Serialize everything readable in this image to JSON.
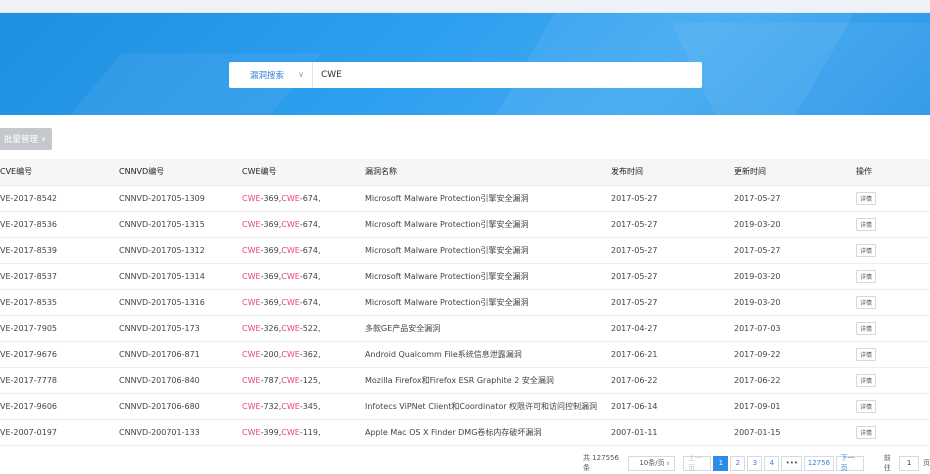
{
  "search": {
    "type_label": "漏洞搜索",
    "value": "CWE"
  },
  "toolbar": {
    "batch_label": "批量管理"
  },
  "table": {
    "headers": [
      "CVE编号",
      "CNNVD编号",
      "CWE编号",
      "漏洞名称",
      "发布时间",
      "更新时间",
      "操作"
    ],
    "cwe_prefix": "CWE",
    "detail_label": "详情",
    "rows": [
      {
        "cve": "VE-2017-8542",
        "cnnvd": "CNNVD-201705-1309",
        "cwe1": "-369,",
        "cwe2": "-674,",
        "name": "Microsoft Malware Protection引擎安全漏洞",
        "pub": "2017-05-27",
        "upd": "2017-05-27"
      },
      {
        "cve": "VE-2017-8536",
        "cnnvd": "CNNVD-201705-1315",
        "cwe1": "-369,",
        "cwe2": "-674,",
        "name": "Microsoft Malware Protection引擎安全漏洞",
        "pub": "2017-05-27",
        "upd": "2019-03-20"
      },
      {
        "cve": "VE-2017-8539",
        "cnnvd": "CNNVD-201705-1312",
        "cwe1": "-369,",
        "cwe2": "-674,",
        "name": "Microsoft Malware Protection引擎安全漏洞",
        "pub": "2017-05-27",
        "upd": "2017-05-27"
      },
      {
        "cve": "VE-2017-8537",
        "cnnvd": "CNNVD-201705-1314",
        "cwe1": "-369,",
        "cwe2": "-674,",
        "name": "Microsoft Malware Protection引擎安全漏洞",
        "pub": "2017-05-27",
        "upd": "2019-03-20"
      },
      {
        "cve": "VE-2017-8535",
        "cnnvd": "CNNVD-201705-1316",
        "cwe1": "-369,",
        "cwe2": "-674,",
        "name": "Microsoft Malware Protection引擎安全漏洞",
        "pub": "2017-05-27",
        "upd": "2019-03-20"
      },
      {
        "cve": "VE-2017-7905",
        "cnnvd": "CNNVD-201705-173",
        "cwe1": "-326,",
        "cwe2": "-522,",
        "name": "多款GE产品安全漏洞",
        "pub": "2017-04-27",
        "upd": "2017-07-03"
      },
      {
        "cve": "VE-2017-9676",
        "cnnvd": "CNNVD-201706-871",
        "cwe1": "-200,",
        "cwe2": "-362,",
        "name": "Android Qualcomm File系统信息泄露漏洞",
        "pub": "2017-06-21",
        "upd": "2017-09-22"
      },
      {
        "cve": "VE-2017-7778",
        "cnnvd": "CNNVD-201706-840",
        "cwe1": "-787,",
        "cwe2": "-125,",
        "name": "Mozilla Firefox和Firefox ESR Graphite 2 安全漏洞",
        "pub": "2017-06-22",
        "upd": "2017-06-22"
      },
      {
        "cve": "VE-2017-9606",
        "cnnvd": "CNNVD-201706-680",
        "cwe1": "-732,",
        "cwe2": "-345,",
        "name": "Infotecs ViPNet Client和Coordinator 权限许可和访问控制漏洞",
        "pub": "2017-06-14",
        "upd": "2017-09-01"
      },
      {
        "cve": "VE-2007-0197",
        "cnnvd": "CNNVD-200701-133",
        "cwe1": "-399,",
        "cwe2": "-119,",
        "name": "Apple Mac OS X Finder DMG卷标内存破坏漏洞",
        "pub": "2007-01-11",
        "upd": "2007-01-15"
      }
    ]
  },
  "pagination": {
    "total_text": "共 127556 条",
    "page_size": "10条/页",
    "prev": "上一页",
    "pages": [
      "1",
      "2",
      "3",
      "4"
    ],
    "ellipsis": "•••",
    "last": "12756",
    "next": "下一页",
    "goto_label": "前往",
    "goto_value": "1",
    "goto_suffix": "页"
  }
}
